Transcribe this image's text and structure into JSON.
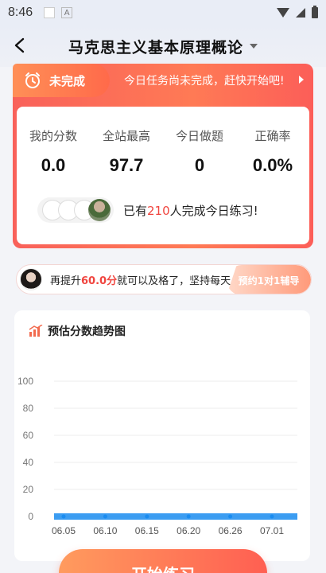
{
  "status_bar": {
    "time": "8:46"
  },
  "header": {
    "title": "马克思主义基本原理概论"
  },
  "task": {
    "status": "未完成",
    "message": "今日任务尚未完成，赶快开始吧!"
  },
  "stats": [
    {
      "label": "我的分数",
      "value": "0.0"
    },
    {
      "label": "全站最高",
      "value": "97.7"
    },
    {
      "label": "今日做题",
      "value": "0"
    },
    {
      "label": "正确率",
      "value": "0.0%"
    }
  ],
  "participants": {
    "prefix": "已有",
    "count": "210",
    "suffix": "人完成今日练习!"
  },
  "tutor": {
    "prefix": "再提升",
    "score": "60.0分",
    "suffix": "就可以及格了，坚持每天…",
    "button": "预约1对1辅导"
  },
  "chart_title": "预估分数趋势图",
  "chart_data": {
    "type": "line",
    "title": "预估分数趋势图",
    "x": [
      "06.05",
      "06.10",
      "06.15",
      "06.20",
      "06.26",
      "07.01"
    ],
    "y_ticks": [
      0,
      20,
      40,
      60,
      80,
      100
    ],
    "ylim": [
      0,
      100
    ],
    "series": [
      {
        "values": [
          0,
          0,
          0,
          0,
          0,
          0
        ]
      }
    ],
    "grid": true,
    "colors": {
      "line": "#1a8cf0"
    }
  },
  "start_button": "开始练习"
}
